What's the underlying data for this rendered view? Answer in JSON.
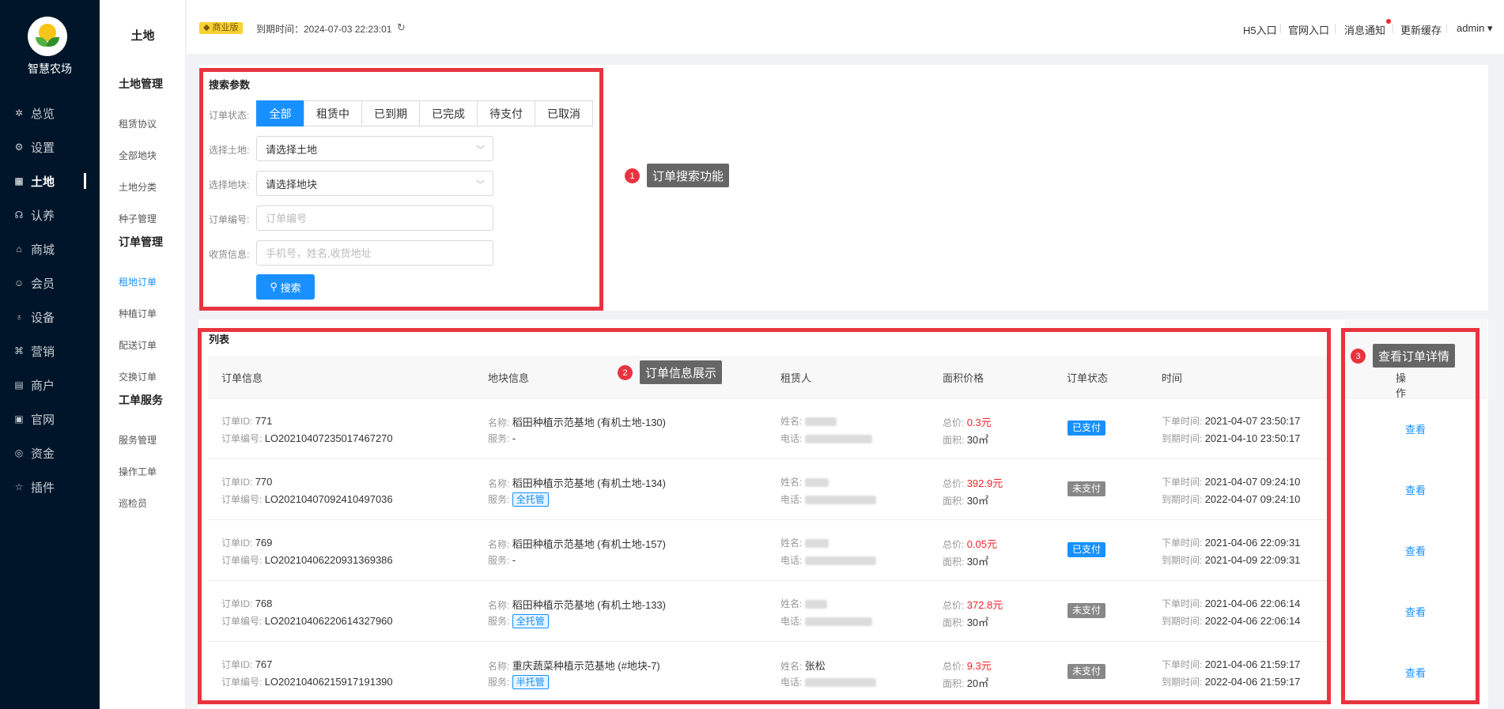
{
  "brand": {
    "name": "智慧农场"
  },
  "nav": [
    {
      "label": "总览",
      "icon": "dashboard-icon",
      "glyph": "✲"
    },
    {
      "label": "设置",
      "icon": "gear-icon",
      "glyph": "⚙"
    },
    {
      "label": "土地",
      "icon": "grid-icon",
      "glyph": "▦"
    },
    {
      "label": "认养",
      "icon": "adopt-icon",
      "glyph": "☊"
    },
    {
      "label": "商城",
      "icon": "shop-icon",
      "glyph": "⌂"
    },
    {
      "label": "会员",
      "icon": "member-icon",
      "glyph": "☺"
    },
    {
      "label": "设备",
      "icon": "device-icon",
      "glyph": "♁"
    },
    {
      "label": "营销",
      "icon": "marketing-icon",
      "glyph": "⌘"
    },
    {
      "label": "商户",
      "icon": "merchant-icon",
      "glyph": "▤"
    },
    {
      "label": "官网",
      "icon": "website-icon",
      "glyph": "▣"
    },
    {
      "label": "资金",
      "icon": "fund-icon",
      "glyph": "◎"
    },
    {
      "label": "插件",
      "icon": "plugin-icon",
      "glyph": "☆"
    }
  ],
  "subnav": {
    "title": "土地",
    "groups": [
      {
        "label": "土地管理",
        "items": [
          "租赁协议",
          "全部地块",
          "土地分类",
          "种子管理"
        ]
      },
      {
        "label": "订单管理",
        "items": [
          "租地订单",
          "种植订单",
          "配送订单",
          "交换订单"
        ]
      },
      {
        "label": "工单服务",
        "items": [
          "服务管理",
          "操作工单",
          "巡检员"
        ]
      }
    ]
  },
  "header": {
    "edition": "商业版",
    "expire": "到期时间：2024-07-03 22:23:01",
    "links": [
      "H5入口",
      "官网入口",
      "消息通知",
      "更新缓存",
      "admin"
    ]
  },
  "search": {
    "title": "搜索参数",
    "status_label": "订单状态:",
    "statuses": [
      "全部",
      "租赁中",
      "已到期",
      "已完成",
      "待支付",
      "已取消"
    ],
    "land_label": "选择土地:",
    "land_value": "请选择土地",
    "plot_label": "选择地块:",
    "plot_value": "请选择地块",
    "order_no_label": "订单编号:",
    "order_no_placeholder": "订单编号",
    "recv_label": "收货信息:",
    "recv_placeholder": "手机号，姓名,收货地址",
    "button": "搜索"
  },
  "list": {
    "title": "列表",
    "columns": [
      "订单信息",
      "地块信息",
      "租赁人",
      "面积价格",
      "订单状态",
      "时间",
      "操作"
    ],
    "labels": {
      "order_id": "订单ID:",
      "order_no": "订单编号:",
      "name": "名称:",
      "service": "服务:",
      "renter_name": "姓名:",
      "phone": "电话:",
      "total": "总价:",
      "area": "面积:",
      "order_time": "下单时间:",
      "expire_time": "到期时间:",
      "view": "查看"
    },
    "rows": [
      {
        "id": "771",
        "no": "LO20210407235017467270",
        "land": "稻田种植示范基地 (有机土地-130)",
        "service": "-",
        "renter": "",
        "total": "0.3元",
        "area": "30㎡",
        "status": "已支付",
        "paid": true,
        "order_time": "2021-04-07 23:50:17",
        "expire_time": "2021-04-10 23:50:17"
      },
      {
        "id": "770",
        "no": "LO20210407092410497036",
        "land": "稻田种植示范基地 (有机土地-134)",
        "service": "全托管",
        "renter": "",
        "total": "392.9元",
        "area": "30㎡",
        "status": "未支付",
        "paid": false,
        "order_time": "2021-04-07 09:24:10",
        "expire_time": "2022-04-07 09:24:10"
      },
      {
        "id": "769",
        "no": "LO20210406220931369386",
        "land": "稻田种植示范基地 (有机土地-157)",
        "service": "-",
        "renter": "",
        "total": "0.05元",
        "area": "30㎡",
        "status": "已支付",
        "paid": true,
        "order_time": "2021-04-06 22:09:31",
        "expire_time": "2021-04-09 22:09:31"
      },
      {
        "id": "768",
        "no": "LO20210406220614327960",
        "land": "稻田种植示范基地 (有机土地-133)",
        "service": "全托管",
        "renter": "",
        "total": "372.8元",
        "area": "30㎡",
        "status": "未支付",
        "paid": false,
        "order_time": "2021-04-06 22:06:14",
        "expire_time": "2022-04-06 22:06:14"
      },
      {
        "id": "767",
        "no": "LO20210406215917191390",
        "land": "重庆蔬菜种植示范基地 (#地块-7)",
        "service": "半托管",
        "renter": "张松",
        "total": "9.3元",
        "area": "20㎡",
        "status": "未支付",
        "paid": false,
        "order_time": "2021-04-06 21:59:17",
        "expire_time": "2022-04-06 21:59:17"
      }
    ]
  },
  "annotations": [
    {
      "num": "1",
      "text": "订单搜索功能"
    },
    {
      "num": "2",
      "text": "订单信息展示"
    },
    {
      "num": "3",
      "text": "查看订单详情"
    }
  ],
  "colors": {
    "primary": "#1890ff",
    "sidebar": "#001529",
    "annotation": "#e8343f",
    "price": "#f5222d"
  }
}
